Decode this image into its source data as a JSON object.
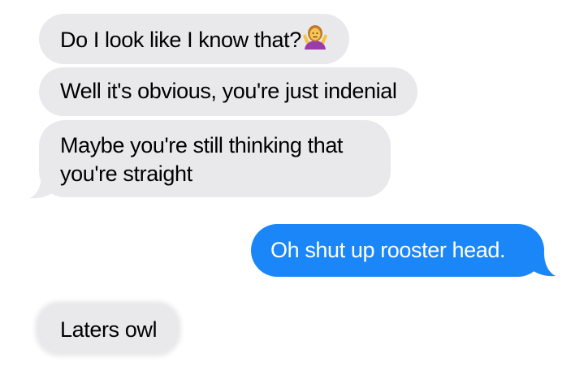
{
  "messages": [
    {
      "direction": "incoming",
      "text": "Do I look like I know that?",
      "emoji": "person-shrugging-emoji"
    },
    {
      "direction": "incoming",
      "text": "Well it's obvious, you're just indenial"
    },
    {
      "direction": "incoming",
      "text": "Maybe you're still thinking that you're straight"
    },
    {
      "direction": "outgoing",
      "text": "Oh shut up rooster head."
    },
    {
      "direction": "incoming",
      "text": "Laters owl"
    }
  ],
  "colors": {
    "incoming_bubble": "#e9e9eb",
    "outgoing_bubble": "#1b86f7",
    "incoming_text": "#000000",
    "outgoing_text": "#ffffff",
    "background": "#ffffff"
  }
}
